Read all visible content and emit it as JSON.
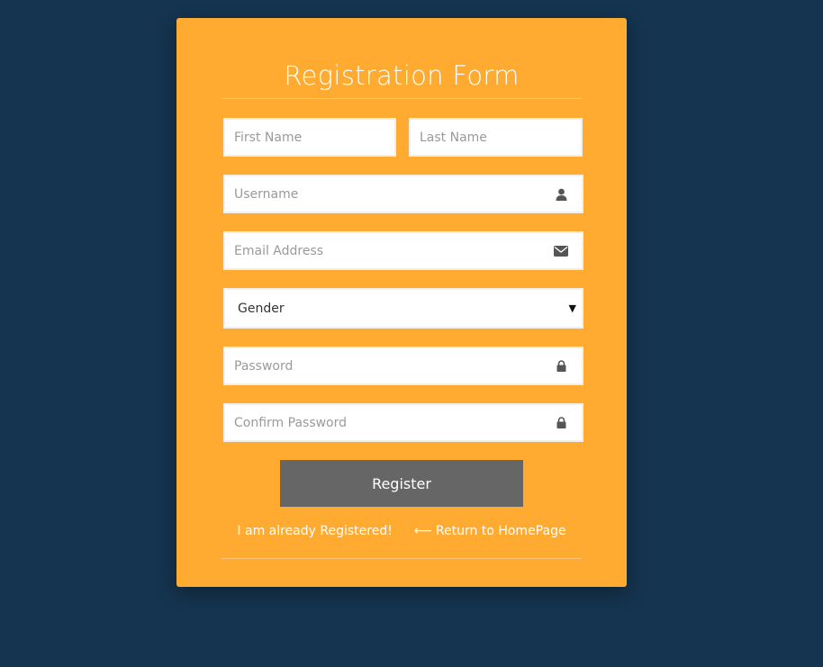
{
  "form": {
    "title": "Registration Form",
    "fields": {
      "first_name": {
        "placeholder": "First Name"
      },
      "last_name": {
        "placeholder": "Last Name"
      },
      "username": {
        "placeholder": "Username",
        "icon": "user-icon"
      },
      "email": {
        "placeholder": "Email Address",
        "icon": "envelope-icon"
      },
      "gender": {
        "value": "Gender",
        "icon": "caret-down-icon"
      },
      "password": {
        "placeholder": "Password",
        "icon": "lock-icon"
      },
      "confirm_password": {
        "placeholder": "Confirm Password",
        "icon": "lock-icon"
      }
    },
    "register_label": "Register",
    "links": {
      "already_registered": "I am already Registered!",
      "return_home": "Return to HomePage",
      "return_home_icon": "arrow-left-icon"
    }
  },
  "colors": {
    "background": "#15344f",
    "card": "#ffab32",
    "button": "#666666",
    "text_light": "#ffffff"
  }
}
